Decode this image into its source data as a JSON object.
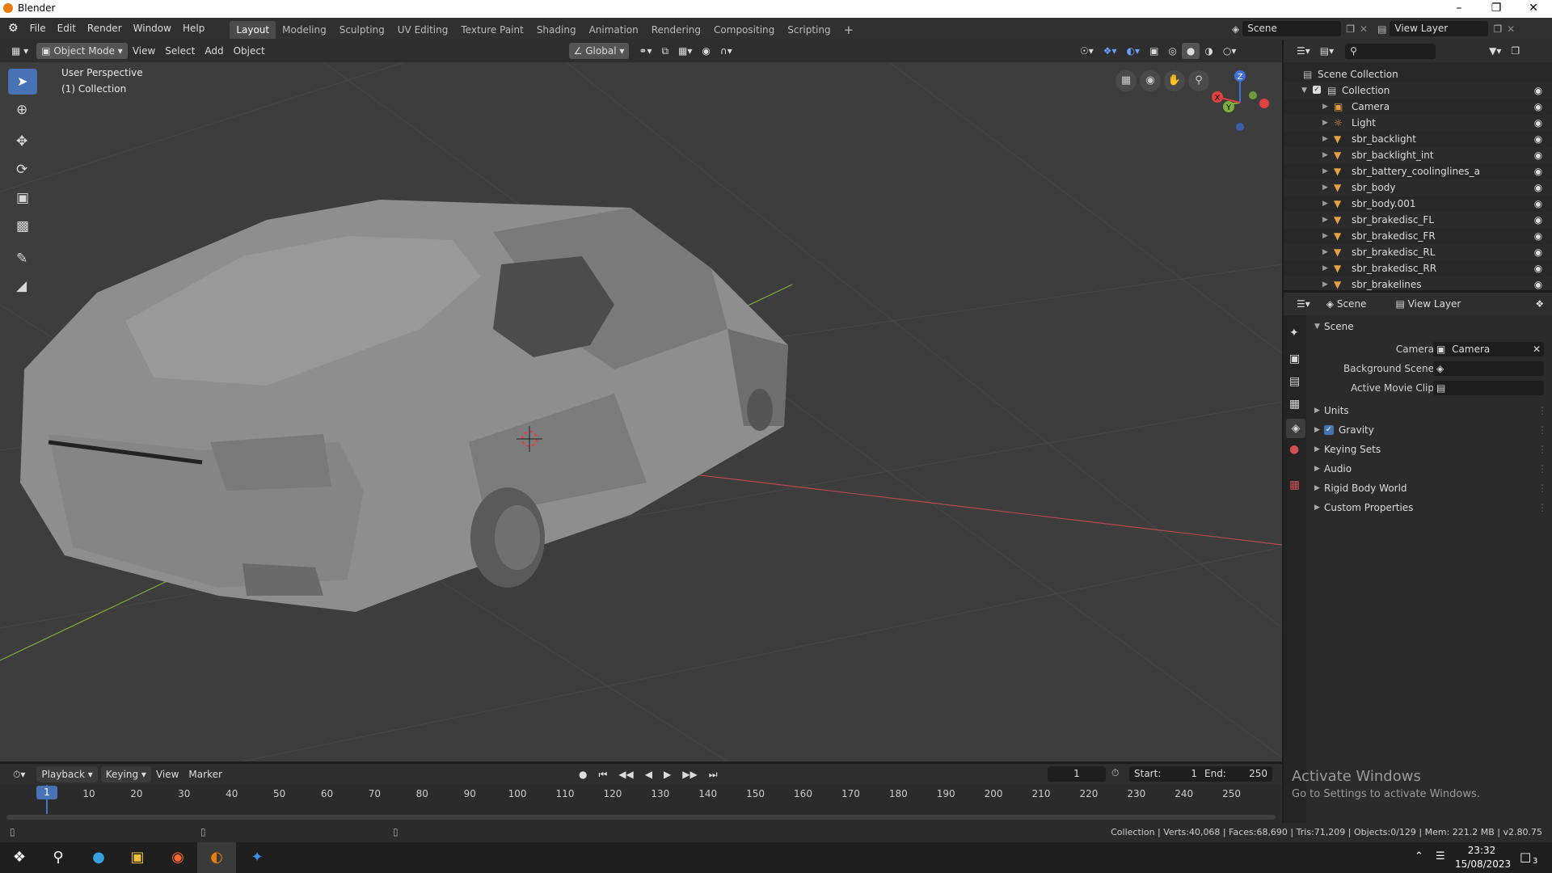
{
  "window": {
    "title": "Blender"
  },
  "menubar": {
    "menus": [
      "File",
      "Edit",
      "Render",
      "Window",
      "Help"
    ],
    "workspaces": [
      "Layout",
      "Modeling",
      "Sculpting",
      "UV Editing",
      "Texture Paint",
      "Shading",
      "Animation",
      "Rendering",
      "Compositing",
      "Scripting"
    ],
    "active_workspace": "Layout",
    "scene": "Scene",
    "view_layer": "View Layer"
  },
  "viewport": {
    "mode": "Object Mode",
    "menus": [
      "View",
      "Select",
      "Add",
      "Object"
    ],
    "orientation": "Global",
    "overlay_title": "User Perspective",
    "overlay_subtitle": "(1) Collection",
    "gizmo": {
      "x": "X",
      "y": "Y",
      "z": "Z"
    }
  },
  "outliner": {
    "root": "Scene Collection",
    "collection": "Collection",
    "items": [
      {
        "name": "Camera",
        "icon": "camera-icon"
      },
      {
        "name": "Light",
        "icon": "light-icon"
      },
      {
        "name": "sbr_backlight",
        "icon": "mesh-icon"
      },
      {
        "name": "sbr_backlight_int",
        "icon": "mesh-icon"
      },
      {
        "name": "sbr_battery_coolinglines_a",
        "icon": "mesh-icon"
      },
      {
        "name": "sbr_body",
        "icon": "mesh-icon"
      },
      {
        "name": "sbr_body.001",
        "icon": "mesh-icon"
      },
      {
        "name": "sbr_brakedisc_FL",
        "icon": "mesh-icon"
      },
      {
        "name": "sbr_brakedisc_FR",
        "icon": "mesh-icon"
      },
      {
        "name": "sbr_brakedisc_RL",
        "icon": "mesh-icon"
      },
      {
        "name": "sbr_brakedisc_RR",
        "icon": "mesh-icon"
      },
      {
        "name": "sbr_brakelines",
        "icon": "mesh-icon"
      }
    ]
  },
  "properties": {
    "tabs": {
      "scene": "Scene",
      "view_layer": "View Layer"
    },
    "panel_title": "Scene",
    "camera_label": "Camera",
    "camera_value": "Camera",
    "background_scene_label": "Background Scene",
    "active_movie_clip_label": "Active Movie Clip",
    "sections": [
      "Units",
      "Gravity",
      "Keying Sets",
      "Audio",
      "Rigid Body World",
      "Custom Properties"
    ],
    "gravity_checked": true
  },
  "timeline": {
    "menus": [
      "Playback",
      "Keying",
      "View",
      "Marker"
    ],
    "current_frame": "1",
    "start_label": "Start:",
    "start": "1",
    "end_label": "End:",
    "end": "250",
    "ticks": [
      1,
      10,
      20,
      30,
      40,
      50,
      60,
      70,
      80,
      90,
      100,
      110,
      120,
      130,
      140,
      150,
      160,
      170,
      180,
      190,
      200,
      210,
      220,
      230,
      240,
      250
    ]
  },
  "status": {
    "text": "Collection | Verts:40,068 | Faces:68,690 | Tris:71,209 | Objects:0/129 | Mem: 221.2 MB | v2.80.75"
  },
  "watermark": {
    "title": "Activate Windows",
    "subtitle": "Go to Settings to activate Windows."
  },
  "taskbar": {
    "time": "23:32",
    "date": "15/08/2023",
    "notification_count": "3"
  },
  "colors": {
    "accent": "#4772b3",
    "active_tab": "#4b4b4b",
    "axis_x": "#e04040",
    "axis_y": "#7ab040",
    "axis_z": "#4070e0",
    "mesh_icon": "#43d2a2",
    "object_icon": "#e8a142"
  }
}
